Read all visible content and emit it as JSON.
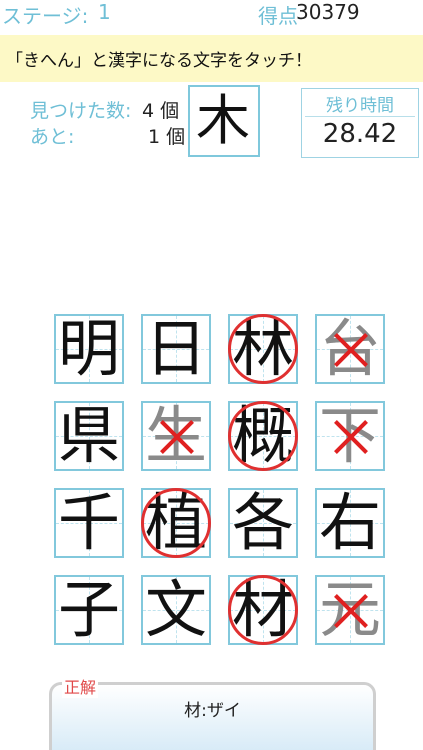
{
  "header": {
    "stage_label": "ステージ:",
    "stage_value": "1",
    "score_label": "得点",
    "score_value": "30379"
  },
  "instruction": "「きへん」と漢字になる文字をタッチ！",
  "status": {
    "found_label": "見つけた数:",
    "found_value": "4 個",
    "remaining_label": "あと:",
    "remaining_value": "1 個"
  },
  "target_radical": "木",
  "timer": {
    "label": "残り時間",
    "value": "28.42"
  },
  "grid": {
    "tiles": [
      {
        "char": "明",
        "state": "none"
      },
      {
        "char": "日",
        "state": "none"
      },
      {
        "char": "林",
        "state": "correct"
      },
      {
        "char": "台",
        "state": "wrong"
      },
      {
        "char": "県",
        "state": "none"
      },
      {
        "char": "生",
        "state": "wrong"
      },
      {
        "char": "概",
        "state": "correct"
      },
      {
        "char": "下",
        "state": "wrong"
      },
      {
        "char": "千",
        "state": "none"
      },
      {
        "char": "植",
        "state": "correct"
      },
      {
        "char": "各",
        "state": "none"
      },
      {
        "char": "右",
        "state": "none"
      },
      {
        "char": "子",
        "state": "none"
      },
      {
        "char": "文",
        "state": "none"
      },
      {
        "char": "材",
        "state": "correct"
      },
      {
        "char": "元",
        "state": "wrong"
      }
    ]
  },
  "answer": {
    "tag": "正解",
    "text": "材:ザイ"
  },
  "colors": {
    "accent": "#6fbfd6",
    "instruction_bg": "#fdf9c6",
    "mark_red": "#e03030"
  }
}
